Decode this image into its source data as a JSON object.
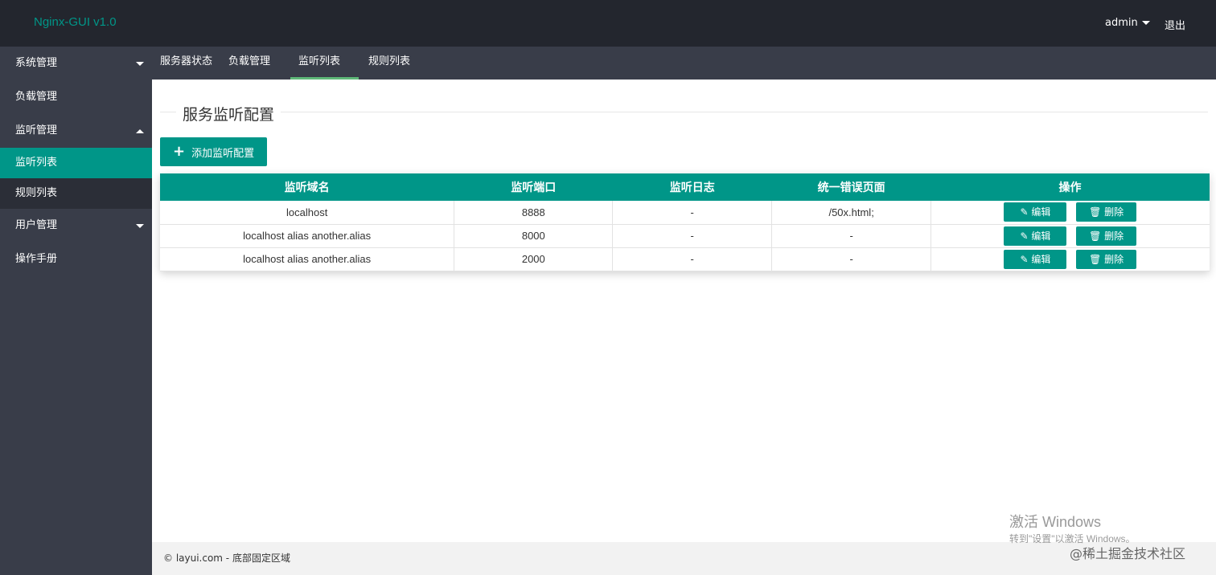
{
  "header": {
    "logo": "Nginx-GUI v1.0",
    "user": "admin",
    "logout": "退出"
  },
  "sidebar": {
    "items": [
      {
        "label": "系统管理",
        "caret": "down"
      },
      {
        "label": "负载管理"
      },
      {
        "label": "监听管理",
        "caret": "up"
      },
      {
        "label": "监听列表",
        "sub": true,
        "active": true
      },
      {
        "label": "规则列表",
        "sub": true
      },
      {
        "label": "用户管理",
        "caret": "down"
      },
      {
        "label": "操作手册"
      }
    ]
  },
  "topnav": {
    "tabs": [
      "服务器状态",
      "负载管理",
      "监听列表",
      "规则列表"
    ],
    "active_index": 2
  },
  "main": {
    "legend": "服务监听配置",
    "add_button": "添加监听配置",
    "table": {
      "headers": [
        "监听域名",
        "监听端口",
        "监听日志",
        "统一错误页面",
        "操作"
      ],
      "rows": [
        [
          "localhost",
          "8888",
          "-",
          "/50x.html;"
        ],
        [
          "localhost alias another.alias",
          "8000",
          "-",
          "-"
        ],
        [
          "localhost alias another.alias",
          "2000",
          "-",
          "-"
        ]
      ],
      "edit_label": "编辑",
      "delete_label": "删除"
    }
  },
  "footer": "© layui.com - 底部固定区域",
  "watermark": {
    "line1": "激活 Windows",
    "line2": "转到\"设置\"以激活 Windows。",
    "line3": "@稀土掘金技术社区"
  },
  "colors": {
    "accent": "#009688",
    "header_bg": "#23262e",
    "sidebar_bg": "#393d49",
    "tab_underline": "#5fb878"
  }
}
